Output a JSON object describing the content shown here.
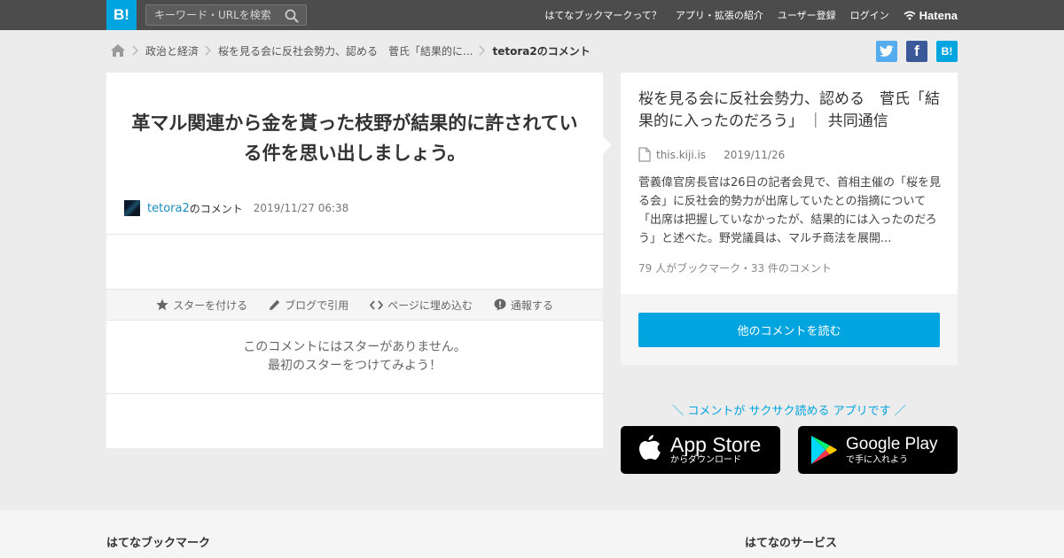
{
  "header": {
    "logo": "B!",
    "search_placeholder": "キーワード・URLを検索",
    "nav": [
      "はてなブックマークって？",
      "アプリ・拡張の紹介",
      "ユーザー登録",
      "ログイン"
    ],
    "hatena_label": "Hatena"
  },
  "breadcrumb": {
    "items": [
      "政治と経済",
      "桜を見る会に反社会勢力、認める　菅氏「結果的に...",
      "tetora2のコメント"
    ]
  },
  "share": {
    "twitter": "t",
    "facebook": "f",
    "hatena": "B!"
  },
  "comment": {
    "text": "革マル関連から金を貰った枝野が結果的に許されている件を思い出しましょう。",
    "username": "tetora2",
    "suffix": "のコメント",
    "timestamp": "2019/11/27 06:38",
    "actions": [
      "スターを付ける",
      "ブログで引用",
      "ページに埋め込む",
      "通報する"
    ],
    "no_star_line1": "このコメントにはスターがありません。",
    "no_star_line2": "最初のスターをつけてみよう！"
  },
  "entry": {
    "title": "桜を見る会に反社会勢力、認める　菅氏「結果的に入ったのだろう」 ｜ 共同通信",
    "domain": "this.kiji.is",
    "date": "2019/11/26",
    "summary": "菅義偉官房長官は26日の記者会見で、首相主催の「桜を見る会」に反社会的勢力が出席していたとの指摘について「出席は把握していなかったが、結果的には入ったのだろう」と述べた。野党議員は、マルチ商法を展開...",
    "counts": "79 人がブックマーク・33 件のコメント",
    "read_button": "他のコメントを読む"
  },
  "promo": {
    "text": "＼ コメントが サクサク読める アプリです ／",
    "appstore_big": "App Store",
    "appstore_small": "からダウンロード",
    "googleplay_big": "Google Play",
    "googleplay_small": "で手に入れよう"
  },
  "footer": {
    "left_heading": "はてなブックマーク",
    "right_heading": "はてなのサービス"
  },
  "colors": {
    "accent": "#00a4de",
    "topbar": "#4c4c4c",
    "twitter": "#55acee",
    "facebook": "#3b5998"
  }
}
